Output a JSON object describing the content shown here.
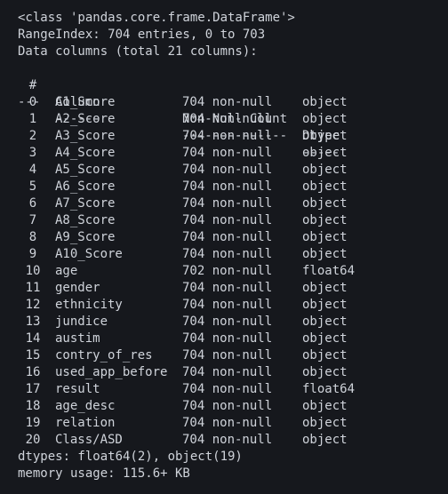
{
  "header": {
    "class_line": "<class 'pandas.core.frame.DataFrame'>",
    "range_index": "RangeIndex: 704 entries, 0 to 703",
    "data_columns": "Data columns (total 21 columns):"
  },
  "table": {
    "headers": {
      "num": "#",
      "column": "Column",
      "non_null": "Non-Null Count",
      "dtype": "Dtype"
    },
    "dividers": {
      "num": "---",
      "column": "------",
      "non_null": "--------------",
      "dtype": "-----"
    },
    "rows": [
      {
        "num": "0",
        "column": "A1_Score",
        "non_null": "704 non-null",
        "dtype": "object"
      },
      {
        "num": "1",
        "column": "A2_Score",
        "non_null": "704 non-null",
        "dtype": "object"
      },
      {
        "num": "2",
        "column": "A3_Score",
        "non_null": "704 non-null",
        "dtype": "object"
      },
      {
        "num": "3",
        "column": "A4_Score",
        "non_null": "704 non-null",
        "dtype": "object"
      },
      {
        "num": "4",
        "column": "A5_Score",
        "non_null": "704 non-null",
        "dtype": "object"
      },
      {
        "num": "5",
        "column": "A6_Score",
        "non_null": "704 non-null",
        "dtype": "object"
      },
      {
        "num": "6",
        "column": "A7_Score",
        "non_null": "704 non-null",
        "dtype": "object"
      },
      {
        "num": "7",
        "column": "A8_Score",
        "non_null": "704 non-null",
        "dtype": "object"
      },
      {
        "num": "8",
        "column": "A9_Score",
        "non_null": "704 non-null",
        "dtype": "object"
      },
      {
        "num": "9",
        "column": "A10_Score",
        "non_null": "704 non-null",
        "dtype": "object"
      },
      {
        "num": "10",
        "column": "age",
        "non_null": "702 non-null",
        "dtype": "float64"
      },
      {
        "num": "11",
        "column": "gender",
        "non_null": "704 non-null",
        "dtype": "object"
      },
      {
        "num": "12",
        "column": "ethnicity",
        "non_null": "704 non-null",
        "dtype": "object"
      },
      {
        "num": "13",
        "column": "jundice",
        "non_null": "704 non-null",
        "dtype": "object"
      },
      {
        "num": "14",
        "column": "austim",
        "non_null": "704 non-null",
        "dtype": "object"
      },
      {
        "num": "15",
        "column": "contry_of_res",
        "non_null": "704 non-null",
        "dtype": "object"
      },
      {
        "num": "16",
        "column": "used_app_before",
        "non_null": "704 non-null",
        "dtype": "object"
      },
      {
        "num": "17",
        "column": "result",
        "non_null": "704 non-null",
        "dtype": "float64"
      },
      {
        "num": "18",
        "column": "age_desc",
        "non_null": "704 non-null",
        "dtype": "object"
      },
      {
        "num": "19",
        "column": "relation",
        "non_null": "704 non-null",
        "dtype": "object"
      },
      {
        "num": "20",
        "column": "Class/ASD",
        "non_null": "704 non-null",
        "dtype": "object"
      }
    ]
  },
  "footer": {
    "dtypes": "dtypes: float64(2), object(19)",
    "memory": "memory usage: 115.6+ KB"
  },
  "colors": {
    "background": "#16181d",
    "text": "#cfd3da"
  }
}
